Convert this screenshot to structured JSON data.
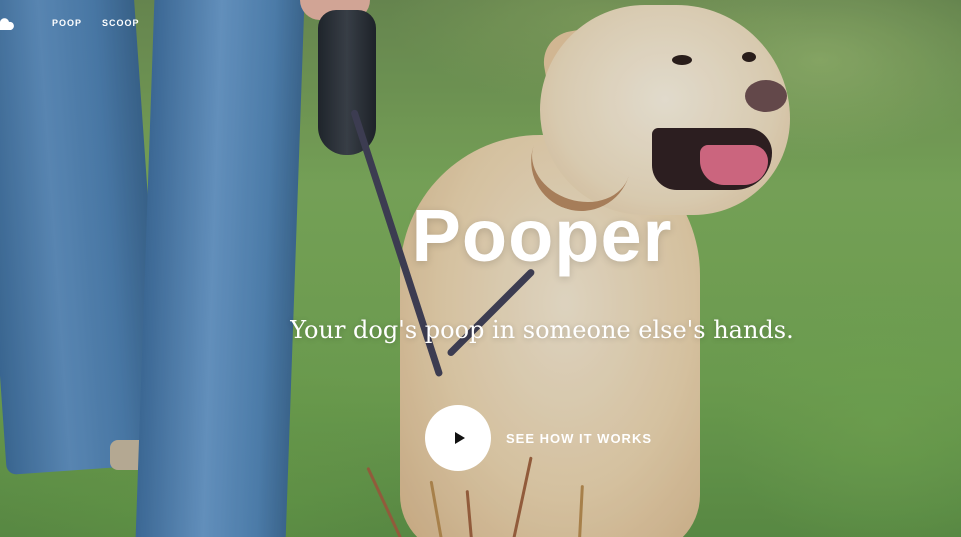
{
  "nav": {
    "logo_icon": "cloud-poop-icon",
    "links": [
      {
        "label": "POOP"
      },
      {
        "label": "SCOOP"
      }
    ]
  },
  "hero": {
    "title": "Pooper",
    "subtitle": "Your dog's poop in someone else's hands.",
    "cta_label": "SEE HOW IT WORKS",
    "cta_icon": "play-icon"
  },
  "colors": {
    "text": "#ffffff",
    "play_button_bg": "#ffffff",
    "play_icon": "#111111"
  }
}
